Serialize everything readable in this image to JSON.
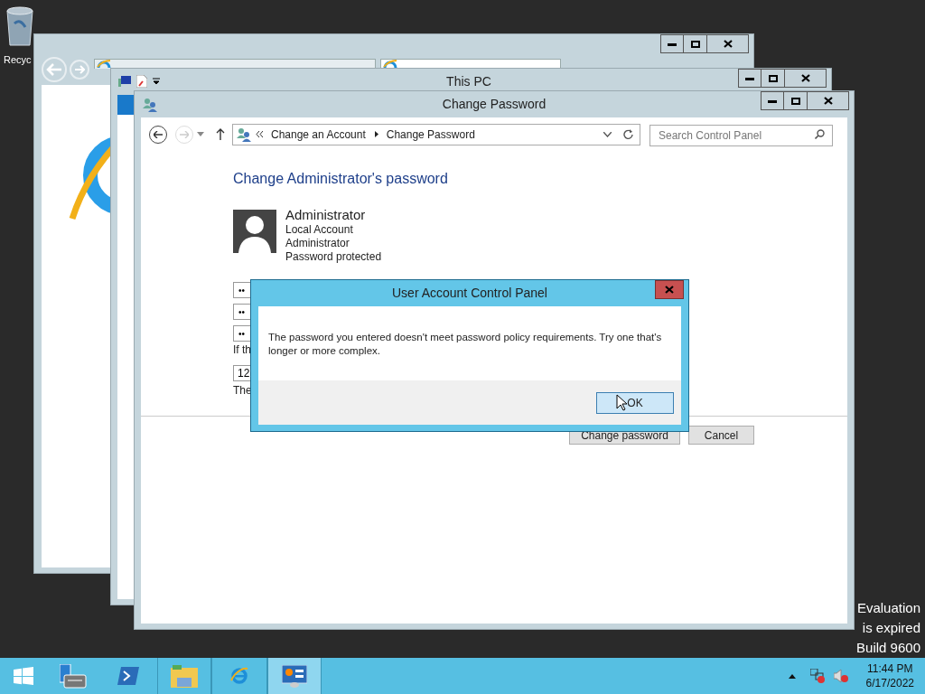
{
  "desktop": {
    "icons": [
      {
        "label": "Recyc"
      }
    ]
  },
  "windows": [
    {
      "kind": "browser"
    },
    {
      "kind": "explorer",
      "title": "This PC"
    },
    {
      "kind": "control_panel",
      "title": "Change Password",
      "breadcrumb": [
        "Change an Account",
        "Change Password"
      ],
      "search": {
        "placeholder": "Search Control Panel"
      },
      "heading": "Change Administrator's password",
      "account": {
        "name": "Administrator",
        "details": [
          "Local Account",
          "Administrator",
          "Password protected"
        ]
      },
      "fields": [
        {
          "value": "••"
        },
        {
          "value": "••"
        },
        {
          "value": "••"
        }
      ],
      "hint": "If th",
      "hint_field": {
        "value": "12"
      },
      "note": "The",
      "buttons": [
        "Change password",
        "Cancel"
      ]
    }
  ],
  "dialog": {
    "title": "User Account Control Panel",
    "message": "The password you entered doesn't meet password policy requirements. Try one that's longer or more complex.",
    "button": "OK"
  },
  "watermark": [
    "Evaluation",
    "is expired",
    "Build 9600"
  ],
  "taskbar": {
    "items": [
      {
        "kind": "start",
        "open": false,
        "selected": false
      },
      {
        "kind": "server_manager",
        "open": false,
        "selected": false
      },
      {
        "kind": "powershell",
        "open": false,
        "selected": false
      },
      {
        "kind": "explorer",
        "open": true,
        "selected": false
      },
      {
        "kind": "browser",
        "open": true,
        "selected": false
      },
      {
        "kind": "control_panel",
        "open": true,
        "selected": true
      }
    ],
    "clock": {
      "time": "11:44 PM",
      "date": "6/17/2022"
    }
  }
}
